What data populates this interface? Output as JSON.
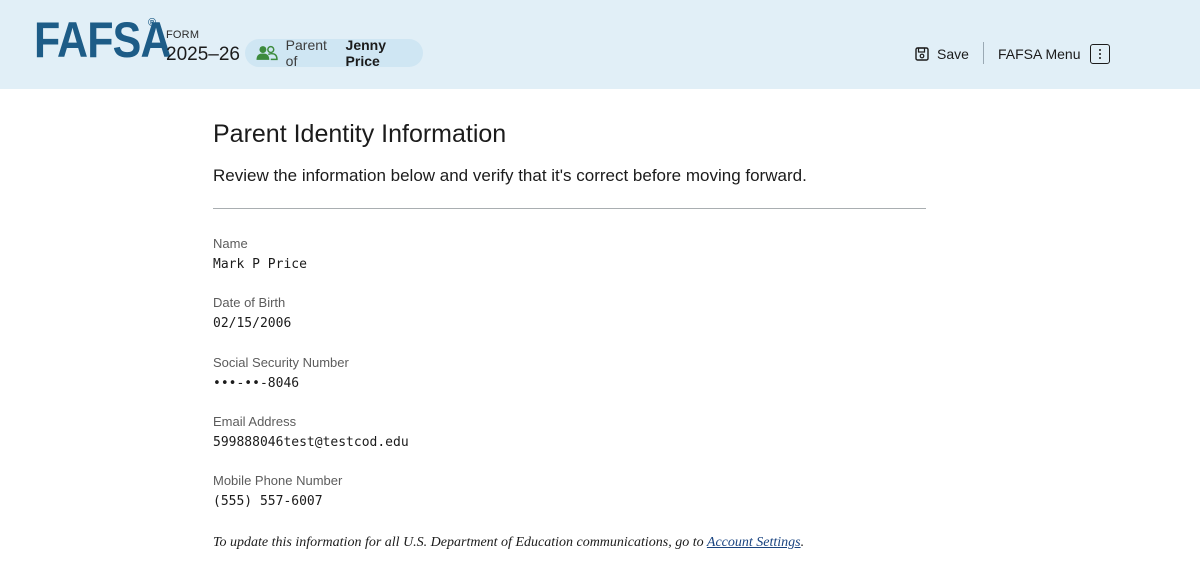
{
  "header": {
    "logo": "FAFSA",
    "registered_mark": "®",
    "form_label": "FORM",
    "form_year": "2025–26",
    "parent_prefix": "Parent of",
    "student_name": "Jenny Price",
    "save_label": "Save",
    "menu_label": "FAFSA Menu",
    "background_color": "#e1eff7",
    "brand_color": "#1d5c87"
  },
  "main": {
    "title": "Parent Identity Information",
    "intro": "Review the information below and verify that it's correct before moving forward.",
    "fields": [
      {
        "label": "Name",
        "value": "Mark P Price"
      },
      {
        "label": "Date of Birth",
        "value": "02/15/2006"
      },
      {
        "label": "Social Security Number",
        "value": "•••-••-8046"
      },
      {
        "label": "Email Address",
        "value": "599888046test@testcod.edu"
      },
      {
        "label": "Mobile Phone Number",
        "value": "(555) 557-6007"
      }
    ],
    "footer_text": "To update this information for all U.S. Department of Education communications, go to",
    "footer_link": "Account Settings",
    "footer_end": "."
  }
}
